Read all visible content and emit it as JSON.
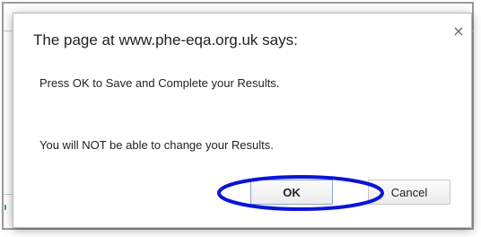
{
  "dialog": {
    "title": "The page at www.phe-eqa.org.uk says:",
    "message_line_1": "Press OK to Save and Complete your Results.",
    "message_line_2": "You will NOT be able to change your Results.",
    "close_glyph": "×",
    "ok_label": "OK",
    "cancel_label": "Cancel"
  },
  "annotation": {
    "highlight_color": "#0a14d8",
    "target": "ok-button"
  },
  "colors": {
    "background_accent": "#2aa198",
    "dialog_text": "#222222"
  },
  "icons": {
    "close": "close-icon"
  }
}
